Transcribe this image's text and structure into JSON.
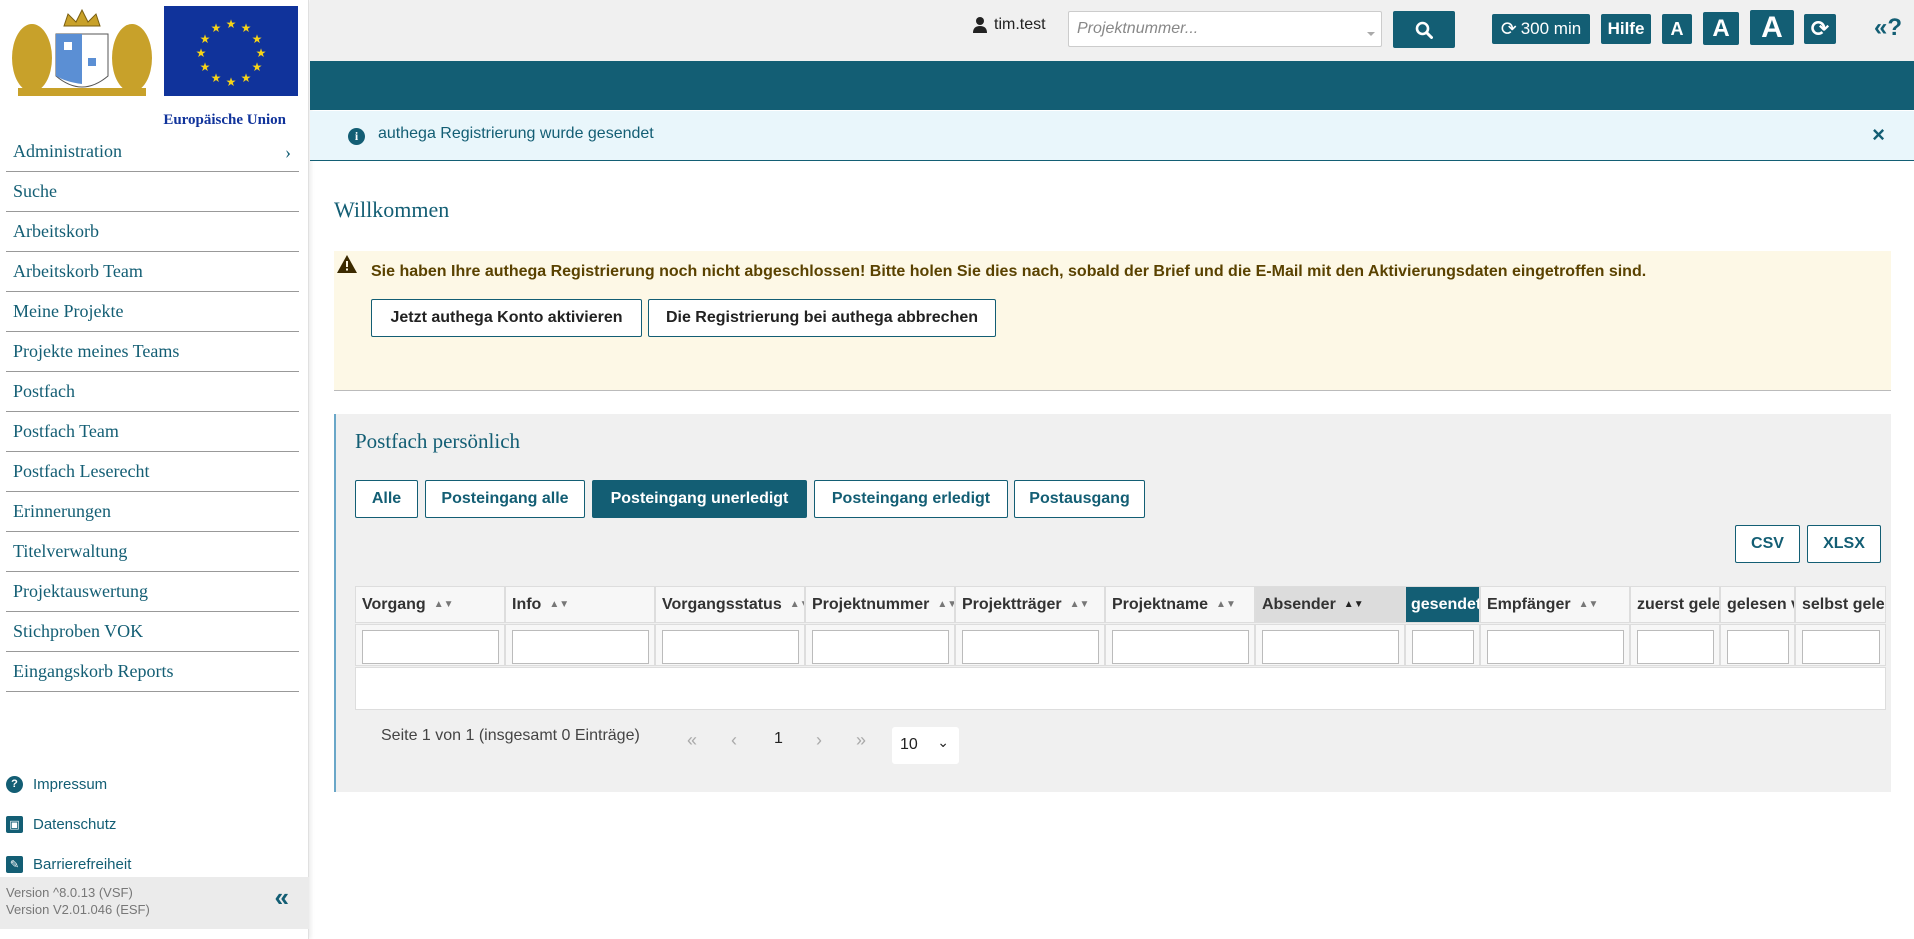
{
  "sidebar": {
    "eu_label": "Europäische Union",
    "nav": [
      {
        "label": "Administration"
      },
      {
        "label": "Suche"
      },
      {
        "label": "Arbeitskorb"
      },
      {
        "label": "Arbeitskorb Team"
      },
      {
        "label": "Meine Projekte"
      },
      {
        "label": "Projekte meines Teams"
      },
      {
        "label": "Postfach"
      },
      {
        "label": "Postfach Team"
      },
      {
        "label": "Postfach Leserecht"
      },
      {
        "label": "Erinnerungen"
      },
      {
        "label": "Titelverwaltung"
      },
      {
        "label": "Projektauswertung"
      },
      {
        "label": "Stichproben VOK"
      },
      {
        "label": "Eingangskorb Reports"
      }
    ],
    "footer_links": [
      "Impressum",
      "Datenschutz",
      "Barrierefreiheit"
    ],
    "version_vsf": "Version ^8.0.13 (VSF)",
    "version_esf": "Version V2.01.046 (ESF)"
  },
  "topbar": {
    "username": "tim.test",
    "search_placeholder": "Projektnummer...",
    "session_label": "300 min",
    "help_label": "Hilfe",
    "font_small": "A",
    "font_medium": "A",
    "font_large": "A",
    "shortcut_label": "«?"
  },
  "info_alert": {
    "text": "authega Registrierung wurde gesendet",
    "close": "×"
  },
  "welcome_title": "Willkommen",
  "warning": {
    "text": "Sie haben Ihre authega Registrierung noch nicht abgeschlossen! Bitte holen Sie dies nach, sobald der Brief und die E-Mail mit den Aktivierungsdaten eingetroffen sind.",
    "activate_label": "Jetzt authega Konto aktivieren",
    "cancel_label": "Die Registrierung bei authega abbrechen"
  },
  "mailbox": {
    "title": "Postfach persönlich",
    "tabs": [
      "Alle",
      "Posteingang alle",
      "Posteingang unerledigt",
      "Posteingang erledigt",
      "Postausgang"
    ],
    "export_csv": "CSV",
    "export_xlsx": "XLSX",
    "columns": [
      "Vorgang",
      "Info",
      "Vorgangsstatus",
      "Projektnummer",
      "Projektträger",
      "Projektname",
      "Absender",
      "gesendet",
      "Empfänger",
      "zuerst gelesen",
      "gelesen von",
      "selbst gelesen"
    ],
    "pager_text": "Seite 1 von 1 (insgesamt 0 Einträge)",
    "current_page": "1",
    "page_size": "10"
  },
  "colors": {
    "primary": "#135e74",
    "info_bg": "#e9f6fb",
    "warn_bg": "#fdf8e6",
    "eu_blue": "#10339b"
  }
}
